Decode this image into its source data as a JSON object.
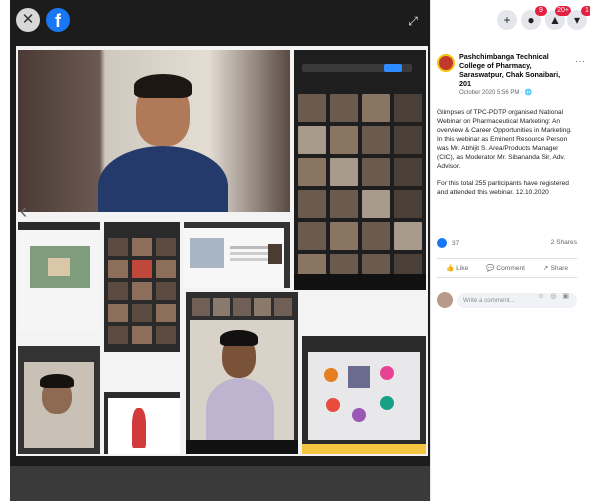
{
  "viewer": {
    "close_icon": "✕",
    "brand_icon": "f",
    "fullscreen_icon": "⤢",
    "prev_icon": "‹"
  },
  "topbar": {
    "add_icon": "+",
    "messenger_badge": "9",
    "notifications_badge": "20+",
    "account_badge": "1"
  },
  "post": {
    "author": "Pashchimbanga Technical College of Pharmacy, Saraswatpur, Chak Sonaibari, 201",
    "meta": "October 2020 5:56 PM · 🌐",
    "more_icon": "···",
    "paragraph1": "Glimpses of TPC-PDTP organised National Webinar on Pharmaceutical Marketing: An overview & Career Opportunities in Marketing. In this webinar as Eminent Resource Person was Mr. Abhijit S. Area/Products Manager (CIC), as Moderator Mr. Sibananda Sir, Adv. Advisor.",
    "paragraph2": "For this total 255 participants have registered and attended this webinar. 12.10.2020",
    "reaction_count": "37",
    "shares": "2 Shares",
    "like_label": "Like",
    "comment_label": "Comment",
    "share_label": "Share",
    "comment_placeholder": "Write a comment...",
    "comment_tools": "☺ ◎ ▣"
  }
}
